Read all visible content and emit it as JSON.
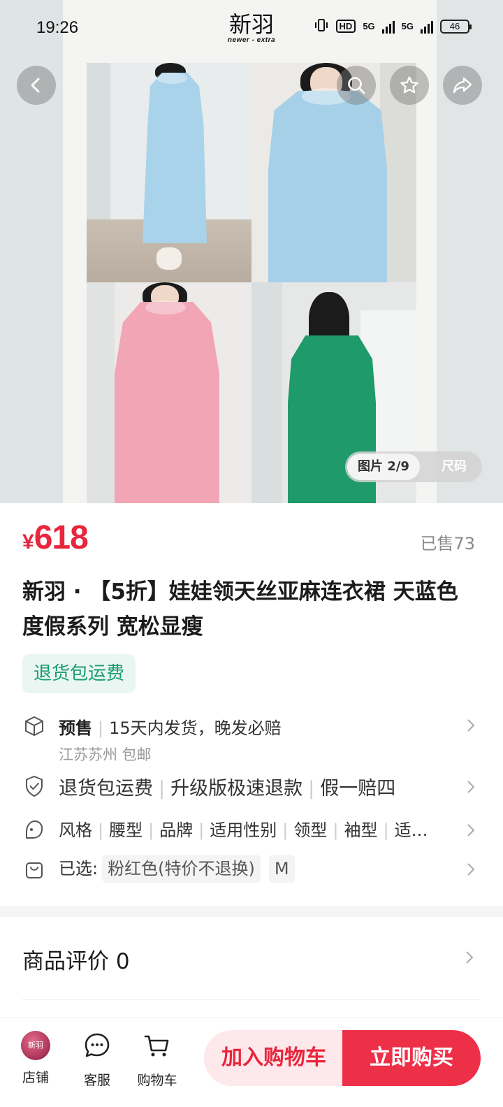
{
  "status_bar": {
    "time": "19:26",
    "hd_label": "HD",
    "net1": "5G",
    "net2": "5G",
    "battery": "46"
  },
  "brand_logo": {
    "cn": "新羽",
    "en": "newer - extra"
  },
  "gallery": {
    "counter": "图片 2/9",
    "size_tab": "尺码",
    "photos": [
      {
        "dress_color": "#a9d3ea",
        "wall": "#e9ecec"
      },
      {
        "dress_color": "#a6d0e8",
        "wall": "#ebeae7"
      },
      {
        "dress_color": "#f2a5b5",
        "wall": "#ecebea"
      },
      {
        "dress_color": "#1f9a6a",
        "wall": "#e6e8e8"
      }
    ]
  },
  "product": {
    "currency": "¥",
    "price": "618",
    "sold": "已售73",
    "title": "新羽 · 【5折】娃娃领天丝亚麻连衣裙 天蓝色 度假系列 宽松显瘦",
    "badge": "退货包运费"
  },
  "shipping": {
    "tag": "预售",
    "text": "15天内发货，晚发必赔",
    "sub": "江苏苏州 包邮"
  },
  "guarantees": [
    "退货包运费",
    "升级版极速退款",
    "假一赔四"
  ],
  "params": [
    "风格",
    "腰型",
    "品牌",
    "适用性别",
    "领型",
    "袖型",
    "适…"
  ],
  "selected": {
    "label": "已选:",
    "color": "粉红色(特价不退换)",
    "size": "M"
  },
  "reviews": {
    "label": "商品评价 0"
  },
  "bottom_bar": {
    "shop_label": "店铺",
    "shop_logo": "新羽",
    "service_label": "客服",
    "cart_label": "购物车",
    "add_cart": "加入购物车",
    "buy_now": "立即购买"
  },
  "colors": {
    "accent": "#e8263c",
    "badge_green": "#1a9c6f"
  }
}
